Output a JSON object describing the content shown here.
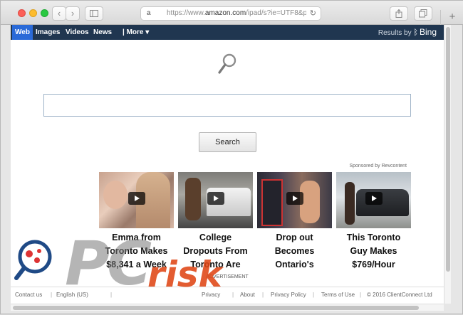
{
  "browser": {
    "address": {
      "favicon_glyph": "a",
      "url_prefix": "https://www.",
      "url_domain": "amazon.com",
      "url_rest": "/ipad/s?ie=UTF8&pag"
    },
    "icons": {
      "back": "chevron-left-icon",
      "forward": "chevron-right-icon",
      "sidebar": "sidebar-icon",
      "share": "share-icon",
      "tabs": "tabs-icon",
      "reload": "reload-icon",
      "new_tab": "plus-icon"
    },
    "glyphs": {
      "back": "‹",
      "forward": "›",
      "reload": "↻",
      "new_tab": "+"
    }
  },
  "bing_bar": {
    "nav": [
      "Web",
      "Images",
      "Videos",
      "News",
      "| More ▾"
    ],
    "active": "Web",
    "results_by": "Results by",
    "bing": "Bing"
  },
  "search": {
    "value": "",
    "button": "Search"
  },
  "sponsored": "Sponsored by Revcontent",
  "ads": [
    {
      "lines": [
        "Emma from",
        "Toronto Makes",
        "$8,341 a Week"
      ]
    },
    {
      "lines": [
        "College",
        "Dropouts From",
        "Toronto Are"
      ]
    },
    {
      "lines": [
        "Drop out",
        "Becomes",
        "Ontario's"
      ]
    },
    {
      "lines": [
        "This Toronto",
        "Guy Makes",
        "$769/Hour"
      ]
    }
  ],
  "advertisement_label": "ADVERTISEMENT",
  "footer": {
    "links": [
      "Contact us",
      "English (US)",
      "Privacy",
      "About",
      "Privacy Policy",
      "Terms of Use"
    ],
    "copyright": "© 2016 ClientConnect Ltd"
  },
  "watermark": {
    "pc": "PC",
    "risk": "risk"
  },
  "colors": {
    "bing_bar": "#203650",
    "active_tab": "#2a6ad8",
    "watermark_orange": "#df4614"
  }
}
